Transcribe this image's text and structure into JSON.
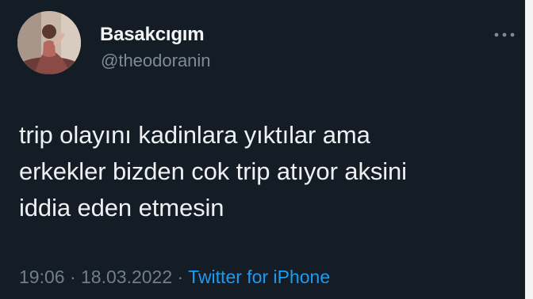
{
  "user": {
    "display_name": "Basakcıgım",
    "handle": "@theodoranin"
  },
  "tweet": {
    "text": "trip olayını kadinlara yıktılar ama\nerkekler bizden cok trip atıyor aksini\niddia eden etmesin",
    "time": "19:06",
    "separator1": " · ",
    "date": "18.03.2022",
    "separator2": " · ",
    "source": "Twitter for iPhone"
  },
  "icons": {
    "more": "more-dots-icon",
    "avatar": "profile-avatar"
  },
  "colors": {
    "background": "#15202b",
    "accent": "#1d9bf0",
    "secondary_text": "#7c8b98"
  }
}
